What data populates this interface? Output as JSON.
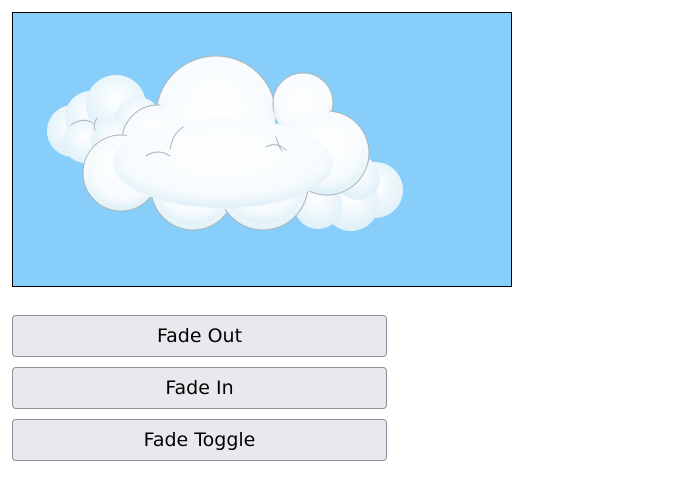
{
  "scene": {
    "sky_color": "#87cefa",
    "cloud_color": "#ffffff",
    "image_subject": "cloud-image"
  },
  "buttons": {
    "fade_out": "Fade Out",
    "fade_in": "Fade In",
    "fade_toggle": "Fade Toggle"
  }
}
